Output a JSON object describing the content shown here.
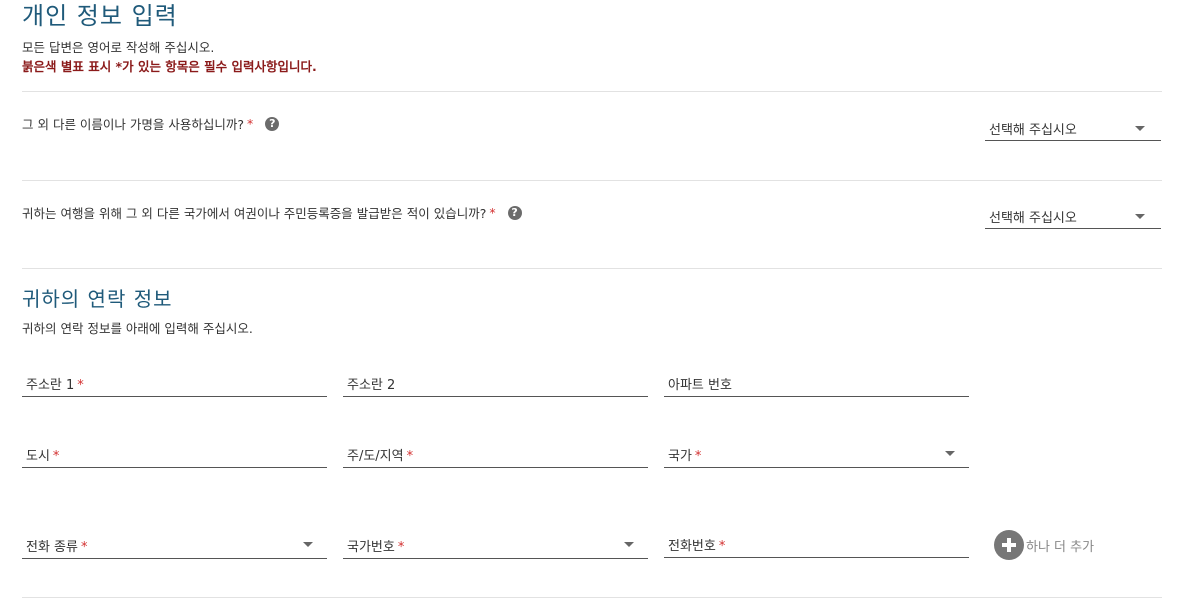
{
  "section_personal": {
    "title": "개인 정보 입력",
    "instruction": "모든 답변은 영어로 작성해 주십시오.",
    "required_note": "붉은색 별표 표시 *가 있는 항목은 필수 입력사항입니다."
  },
  "questions": [
    {
      "label": "그 외 다른 이름이나 가명을 사용하십니까?",
      "required_mark": "*",
      "help_icon": "?",
      "select_value": "선택해 주십시오"
    },
    {
      "label": "귀하는 여행을 위해 그 외 다른 국가에서 여권이나 주민등록증을 발급받은 적이 있습니까?",
      "required_mark": "*",
      "help_icon": "?",
      "select_value": "선택해 주십시오"
    }
  ],
  "section_contact": {
    "title": "귀하의 연락 정보",
    "instruction": "귀하의 연락 정보를 아래에 입력해 주십시오."
  },
  "fields": {
    "address1": {
      "label": "주소란 1",
      "required_mark": "*"
    },
    "address2": {
      "label": "주소란 2"
    },
    "apartment": {
      "label": "아파트 번호"
    },
    "city": {
      "label": "도시",
      "required_mark": "*"
    },
    "state": {
      "label": "주/도/지역",
      "required_mark": "*"
    },
    "country": {
      "label": "국가",
      "required_mark": "*"
    },
    "phone_type": {
      "label": "전화 종류",
      "required_mark": "*"
    },
    "country_code": {
      "label": "국가번호",
      "required_mark": "*"
    },
    "phone_number": {
      "label": "전화번호",
      "required_mark": "*"
    }
  },
  "add_more": {
    "label": "하나 더 추가"
  },
  "colors": {
    "heading": "#1f5a7a",
    "required": "#d32f2f",
    "required_note": "#8b1a1a"
  }
}
